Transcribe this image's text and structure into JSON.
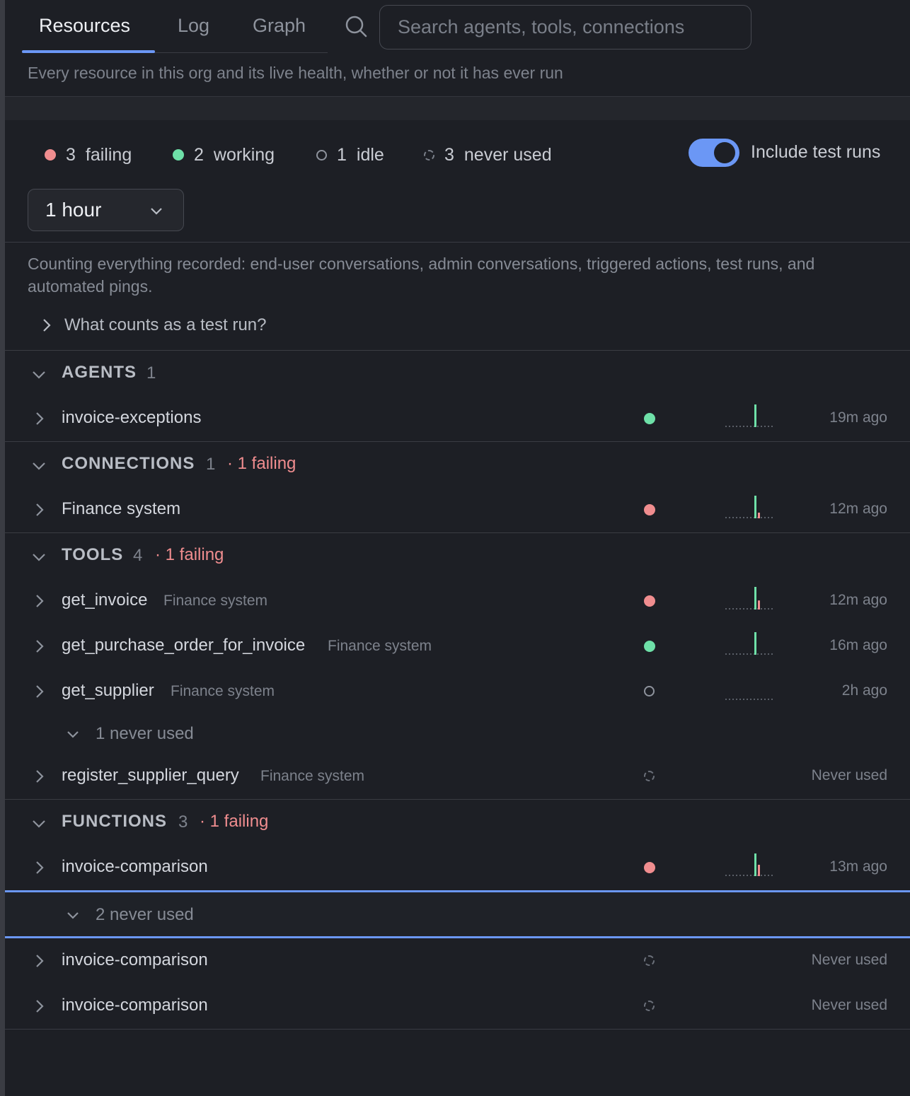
{
  "tabs": [
    {
      "label": "Resources",
      "active": true
    },
    {
      "label": "Log",
      "active": false
    },
    {
      "label": "Graph",
      "active": false
    }
  ],
  "search": {
    "placeholder": "Search agents, tools, connections"
  },
  "header": {
    "description": "Every resource in this org and its live health, whether or not it has ever run"
  },
  "stats": {
    "failing": {
      "count": "3",
      "label": "failing"
    },
    "working": {
      "count": "2",
      "label": "working"
    },
    "idle": {
      "count": "1",
      "label": "idle"
    },
    "never": {
      "count": "3",
      "label": "never used"
    }
  },
  "toggle": {
    "label": "Include test runs",
    "on": true
  },
  "range": {
    "selected": "1 hour"
  },
  "info": {
    "text": "Counting everything recorded: end-user conversations, admin conversations, triggered actions, test runs, and automated pings.",
    "disclosure": "What counts as a test run?"
  },
  "colors": {
    "accent": "#6b97f5",
    "failing": "#f08d8f",
    "working": "#6ee0a8"
  },
  "sections": {
    "agents": {
      "title": "AGENTS",
      "count": "1",
      "rows": [
        {
          "name": "invoice-exceptions",
          "status": "working",
          "time": "19m ago",
          "spark": {
            "ok": 1,
            "fail": 0
          }
        }
      ]
    },
    "connections": {
      "title": "CONNECTIONS",
      "count": "1",
      "failing": "· 1 failing",
      "rows": [
        {
          "name": "Finance system",
          "status": "failing",
          "time": "12m ago",
          "spark": {
            "ok": 1,
            "fail": 0.25
          }
        }
      ]
    },
    "tools": {
      "title": "TOOLS",
      "count": "4",
      "failing": "· 1 failing",
      "rows": [
        {
          "name": "get_invoice",
          "sub": "Finance system",
          "status": "failing",
          "time": "12m ago",
          "spark": {
            "ok": 1,
            "fail": 0.4
          }
        },
        {
          "name": "get_purchase_order_for_invoice",
          "sub": "Finance system",
          "status": "working",
          "time": "16m ago",
          "spark": {
            "ok": 1,
            "fail": 0
          }
        },
        {
          "name": "get_supplier",
          "sub": "Finance system",
          "status": "idle",
          "time": "2h ago",
          "spark": {
            "ok": 0,
            "fail": 0
          }
        }
      ],
      "never_label": "1 never used",
      "never_rows": [
        {
          "name": "register_supplier_query",
          "sub": "Finance system",
          "status": "never",
          "time": "Never used"
        }
      ]
    },
    "functions": {
      "title": "FUNCTIONS",
      "count": "3",
      "failing": "· 1 failing",
      "rows": [
        {
          "name": "invoice-comparison",
          "status": "failing",
          "time": "13m ago",
          "spark": {
            "ok": 1,
            "fail": 0.5
          }
        }
      ],
      "never_label": "2 never used",
      "never_rows": [
        {
          "name": "invoice-comparison",
          "status": "never",
          "time": "Never used"
        },
        {
          "name": "invoice-comparison",
          "status": "never",
          "time": "Never used"
        }
      ]
    }
  }
}
